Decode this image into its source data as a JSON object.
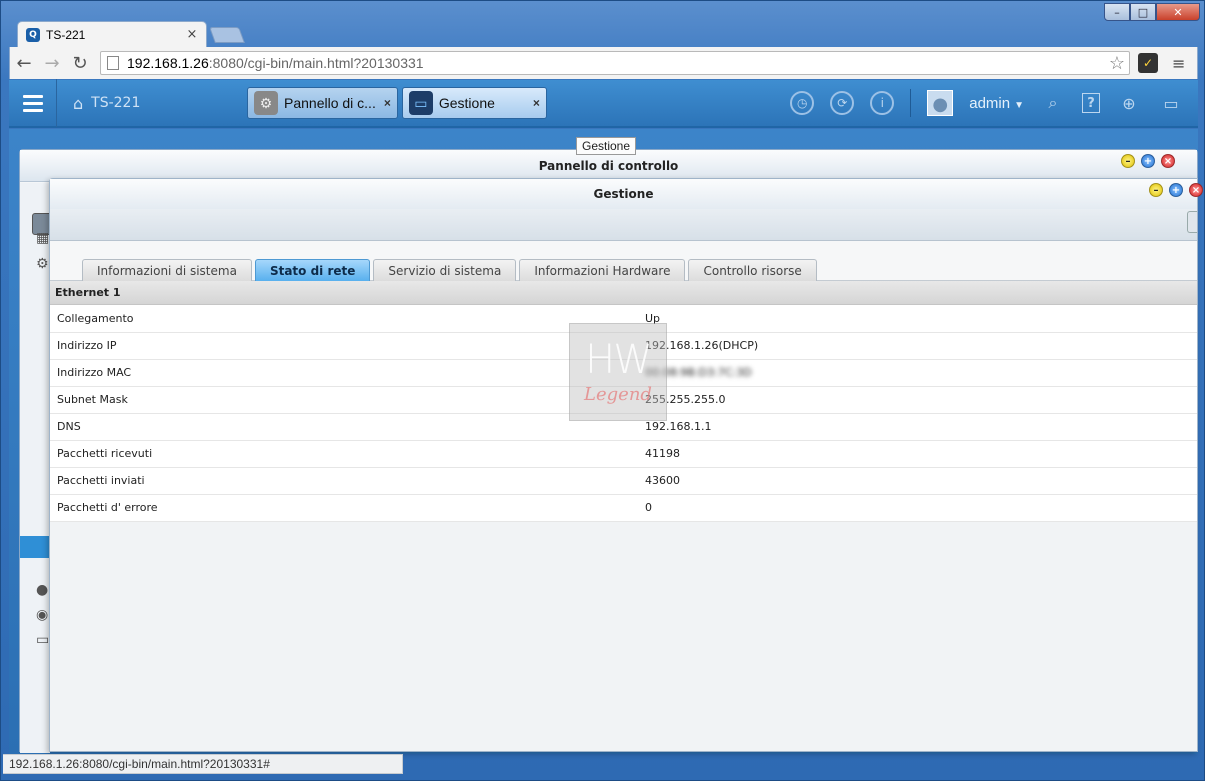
{
  "browser": {
    "tab_title": "TS-221",
    "tab_favicon": "Q",
    "tab_close": "×",
    "url_host": "192.168.1.26",
    "url_rest": ":8080/cgi-bin/main.html?20130331",
    "status_url": "192.168.1.26:8080/cgi-bin/main.html?20130331#",
    "icons": {
      "back": "←",
      "forward": "→",
      "reload": "↻",
      "star": "☆",
      "menu": "≡"
    }
  },
  "qnap": {
    "device_name": "TS-221",
    "app_tabs": [
      {
        "label": "Pannello di c...",
        "close": "×"
      },
      {
        "label": "Gestione",
        "close": "×"
      }
    ],
    "username": "admin",
    "tooltip": "Gestione"
  },
  "bg_window": {
    "title": "Pannello di controllo"
  },
  "fg_window": {
    "title": "Gestione",
    "tabs": [
      "Informazioni di sistema",
      "Stato di rete",
      "Servizio di sistema",
      "Informazioni Hardware",
      "Controllo risorse"
    ],
    "active_tab": "Stato di rete",
    "section": "Ethernet 1",
    "rows": [
      {
        "label": "Collegamento",
        "value": "Up"
      },
      {
        "label": "Indirizzo IP",
        "value": "192.168.1.26(DHCP)"
      },
      {
        "label": "Indirizzo MAC",
        "value": "00:08:9B:D3:7C:3D"
      },
      {
        "label": "Subnet Mask",
        "value": "255.255.255.0"
      },
      {
        "label": "DNS",
        "value": "192.168.1.1"
      },
      {
        "label": "Pacchetti ricevuti",
        "value": "41198"
      },
      {
        "label": "Pacchetti inviati",
        "value": "43600"
      },
      {
        "label": "Pacchetti d'  errore",
        "value": "0"
      }
    ]
  },
  "watermark": {
    "top": "HW",
    "bottom": "Legend"
  },
  "colors": {
    "qnap_bar": "#3f8ed1",
    "active_tab": "#58b0ee",
    "browser_frame": "#3a77bf"
  }
}
